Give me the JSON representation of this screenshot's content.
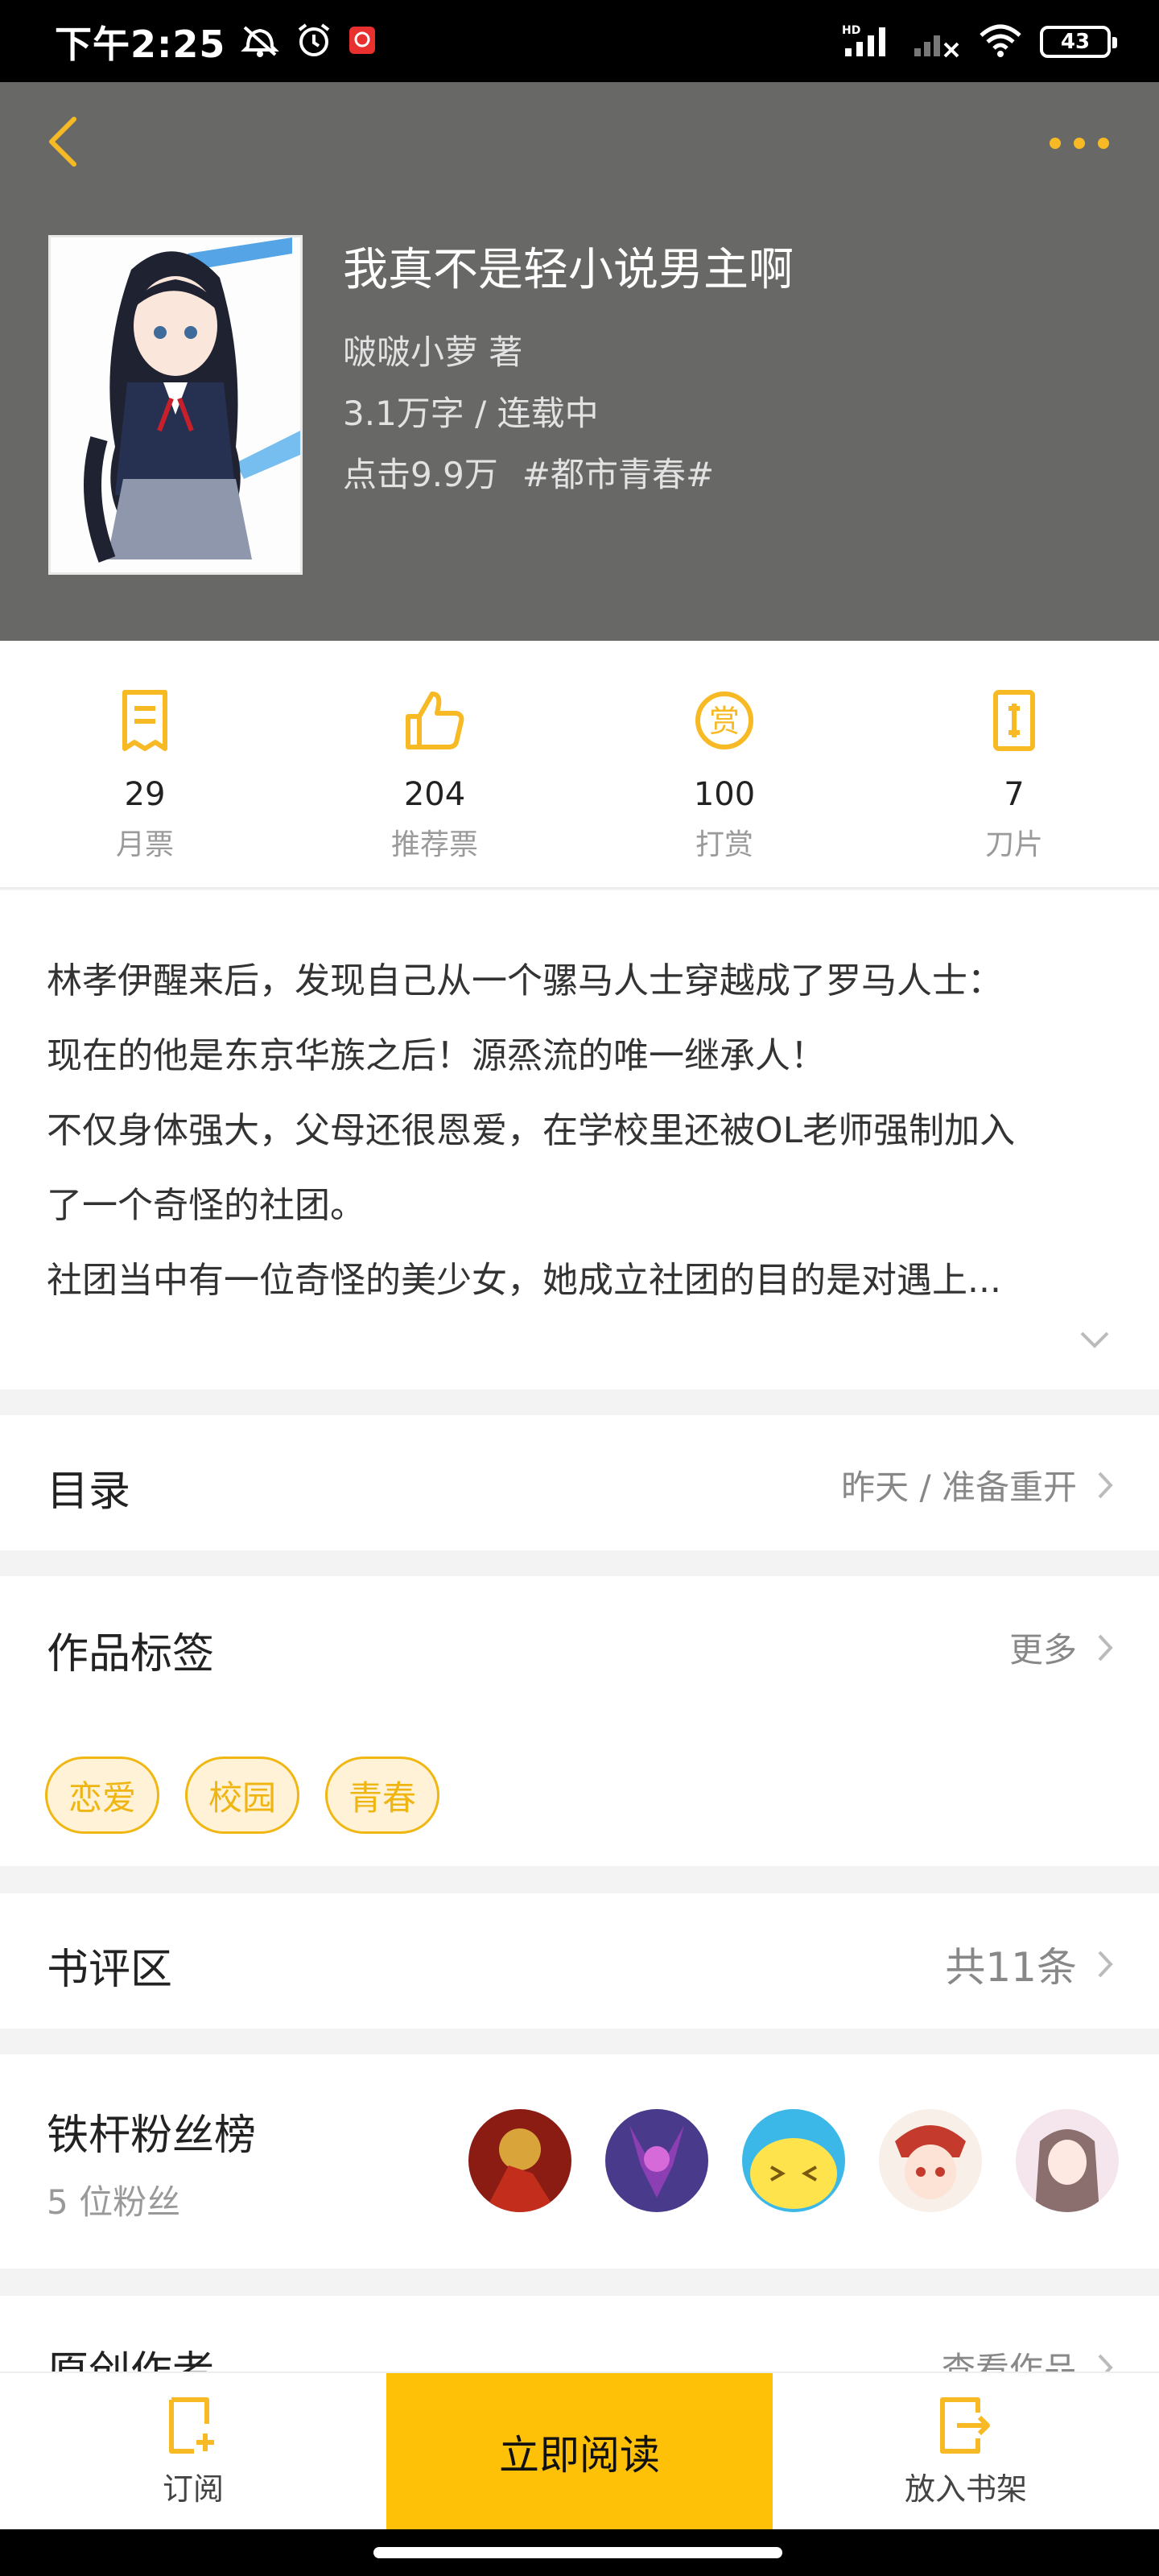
{
  "status_bar": {
    "time": "下午2:25",
    "network": "HD",
    "battery": "43"
  },
  "header": {
    "title": "我真不是轻小说男主啊",
    "author_line": "啵啵小萝  著",
    "meta_line": "3.1万字 / 连载中",
    "clicks": "点击9.9万",
    "category": "#都市青春#"
  },
  "stats": [
    {
      "value": "29",
      "label": "月票",
      "icon": "ticket-icon"
    },
    {
      "value": "204",
      "label": "推荐票",
      "icon": "thumbs-up-icon"
    },
    {
      "value": "100",
      "label": "打赏",
      "icon": "reward-icon"
    },
    {
      "value": "7",
      "label": "刀片",
      "icon": "blade-icon"
    }
  ],
  "intro": {
    "lines": [
      "林孝伊醒来后，发现自己从一个骡马人士穿越成了罗马人士：",
      "现在的他是东京华族之后！源烝流的唯一继承人！",
      "不仅身体强大，父母还很恩爱，在学校里还被OL老师强制加入",
      "了一个奇怪的社团。",
      "社团当中有一位奇怪的美少女，她成立社团的目的是对遇上..."
    ]
  },
  "toc": {
    "title": "目录",
    "latest": "昨天 / 准备重开"
  },
  "tags": {
    "title": "作品标签",
    "more": "更多",
    "items": [
      "恋爱",
      "校园",
      "青春"
    ]
  },
  "reviews": {
    "title": "书评区",
    "count": "共11条"
  },
  "fans": {
    "title": "铁杆粉丝榜",
    "count": "5 位粉丝",
    "avatar_colors": [
      "#8a1c14",
      "#4a3a8c",
      "#3cb8e8",
      "#c43b2e",
      "#b89aa6"
    ]
  },
  "author_section": {
    "title": "原创作者",
    "link": "查看作品"
  },
  "bottom_bar": {
    "subscribe": "订阅",
    "read": "立即阅读",
    "add_shelf": "放入书架"
  },
  "colors": {
    "accent": "#f7b924",
    "header_bg": "#686967",
    "read_button": "#ffc107"
  }
}
